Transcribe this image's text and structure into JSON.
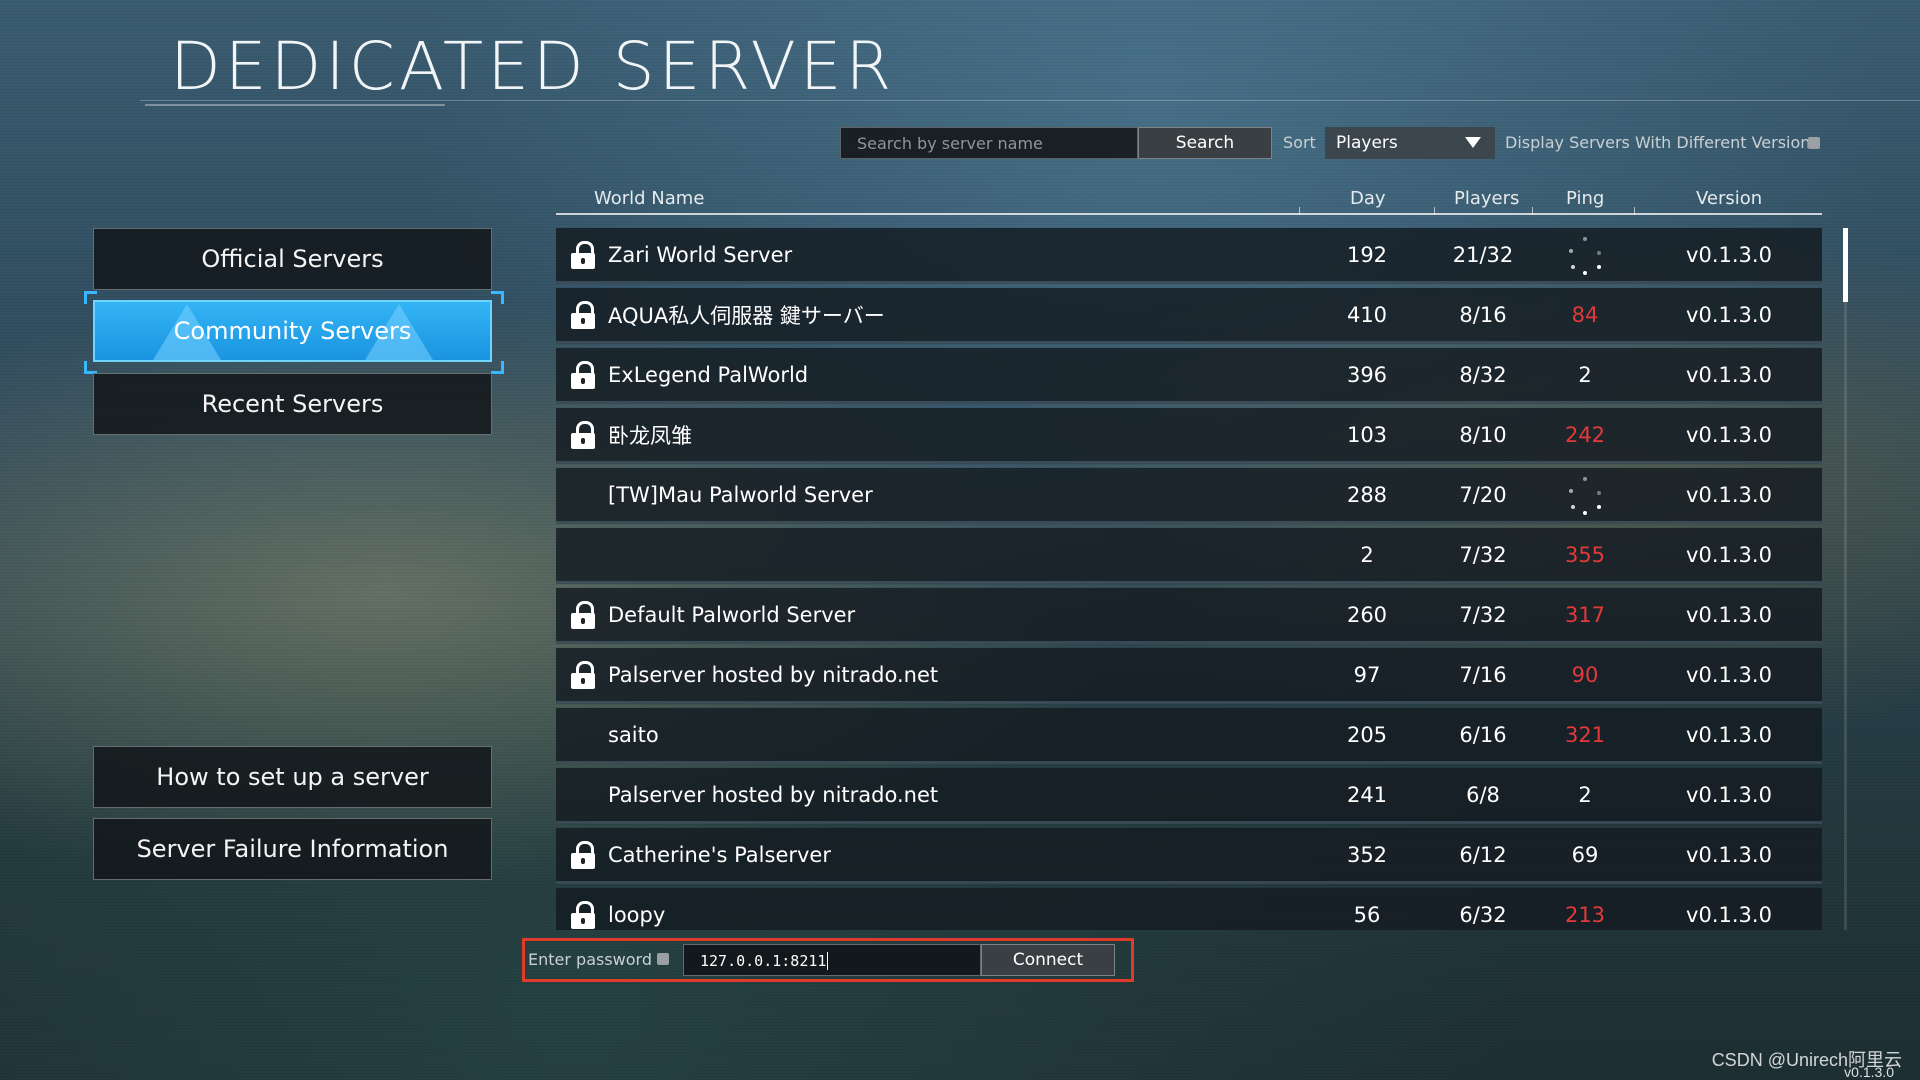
{
  "page": {
    "title": "DEDICATED SERVER"
  },
  "menu": {
    "items": [
      {
        "label": "Official Servers",
        "active": false
      },
      {
        "label": "Community Servers",
        "active": true
      },
      {
        "label": "Recent Servers",
        "active": false
      }
    ],
    "bottom_items": [
      {
        "label": "How to set up a server"
      },
      {
        "label": "Server Failure Information"
      }
    ]
  },
  "toolbar": {
    "search_placeholder": "Search by server name",
    "search_label": "Search",
    "sort_label": "Sort",
    "sort_value": "Players",
    "versions_label": "Display Servers With Different Versions",
    "versions_checked": false
  },
  "table": {
    "headers": {
      "world": "World Name",
      "day": "Day",
      "players": "Players",
      "ping": "Ping",
      "version": "Version"
    },
    "rows": [
      {
        "locked": true,
        "name": "Zari World Server",
        "day": "192",
        "players": "21/32",
        "ping": "",
        "ping_state": "loading",
        "version": "v0.1.3.0"
      },
      {
        "locked": true,
        "name": "AQUA私人伺服器 鍵サーバー",
        "day": "410",
        "players": "8/16",
        "ping": "84",
        "ping_state": "high",
        "version": "v0.1.3.0"
      },
      {
        "locked": true,
        "name": "ExLegend PalWorld",
        "day": "396",
        "players": "8/32",
        "ping": "2",
        "ping_state": "normal",
        "version": "v0.1.3.0"
      },
      {
        "locked": true,
        "name": "卧龙凤雏",
        "day": "103",
        "players": "8/10",
        "ping": "242",
        "ping_state": "high",
        "version": "v0.1.3.0"
      },
      {
        "locked": false,
        "name": "[TW]Mau Palworld Server",
        "day": "288",
        "players": "7/20",
        "ping": "",
        "ping_state": "loading",
        "version": "v0.1.3.0"
      },
      {
        "locked": false,
        "name": "",
        "day": "2",
        "players": "7/32",
        "ping": "355",
        "ping_state": "high",
        "version": "v0.1.3.0"
      },
      {
        "locked": true,
        "name": "Default Palworld Server",
        "day": "260",
        "players": "7/32",
        "ping": "317",
        "ping_state": "high",
        "version": "v0.1.3.0"
      },
      {
        "locked": true,
        "name": "Palserver hosted by nitrado.net",
        "day": "97",
        "players": "7/16",
        "ping": "90",
        "ping_state": "high",
        "version": "v0.1.3.0"
      },
      {
        "locked": false,
        "name": "saito",
        "day": "205",
        "players": "6/16",
        "ping": "321",
        "ping_state": "high",
        "version": "v0.1.3.0"
      },
      {
        "locked": false,
        "name": "Palserver hosted by nitrado.net",
        "day": "241",
        "players": "6/8",
        "ping": "2",
        "ping_state": "normal",
        "version": "v0.1.3.0"
      },
      {
        "locked": true,
        "name": "Catherine's Palserver",
        "day": "352",
        "players": "6/12",
        "ping": "69",
        "ping_state": "normal",
        "version": "v0.1.3.0"
      },
      {
        "locked": true,
        "name": "loopy",
        "day": "56",
        "players": "6/32",
        "ping": "213",
        "ping_state": "high",
        "version": "v0.1.3.0"
      }
    ]
  },
  "connect": {
    "password_label": "Enter password",
    "password_checked": false,
    "address_value": "127.0.0.1:8211",
    "connect_label": "Connect"
  },
  "footer": {
    "watermark": "CSDN @Unirech阿里云",
    "version": "v0.1.3.0"
  },
  "colors": {
    "accent": "#2aa8f0",
    "ping_high": "#e23a3a",
    "highlight_frame": "#e03a2d"
  }
}
